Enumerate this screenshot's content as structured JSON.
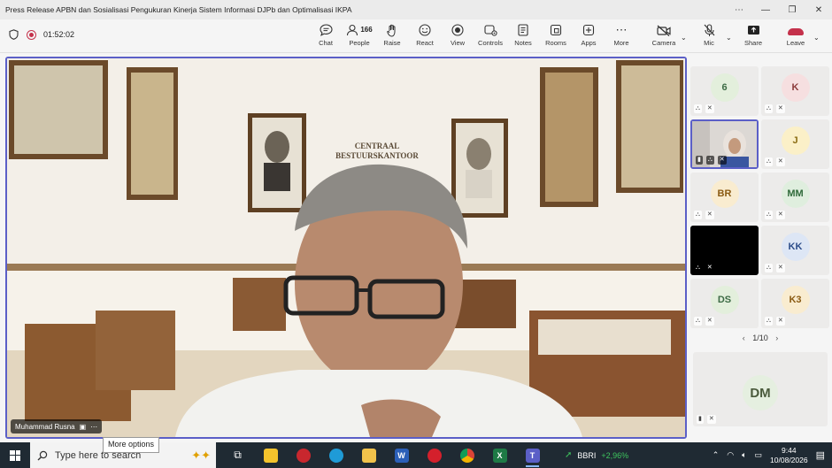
{
  "window": {
    "title": "Press Release APBN dan Sosialisasi Pengukuran Kinerja Sistem Informasi DJPb dan Optimalisasi IKPA",
    "buttons": [
      "⋯",
      "—",
      "❐",
      "✕"
    ]
  },
  "meeting": {
    "timer": "01:52:02",
    "toolbar": {
      "chat": "Chat",
      "people": "People",
      "people_count": "166",
      "raise": "Raise",
      "react": "React",
      "view": "View",
      "controls": "Controls",
      "notes": "Notes",
      "rooms": "Rooms",
      "apps": "Apps",
      "more": "More",
      "camera": "Camera",
      "mic": "Mic",
      "share": "Share",
      "leave": "Leave"
    },
    "main_speaker": {
      "name": "Muhammad Rusna",
      "scene_sign_line1": "CENTRAAL",
      "scene_sign_line2": "BESTUURSKANTOOR"
    },
    "tooltip": "More options",
    "participants": [
      {
        "initials": "6",
        "bg": "#e3efdc",
        "fg": "#3d6b45"
      },
      {
        "initials": "K",
        "bg": "#f6dfe0",
        "fg": "#8b3a3a"
      },
      {
        "initials": "",
        "bg": "#d9d4d0",
        "fg": "#333",
        "video": true
      },
      {
        "initials": "J",
        "bg": "#fbf0c8",
        "fg": "#8a6b12"
      },
      {
        "initials": "BR",
        "bg": "#f9ecd0",
        "fg": "#8a5a12"
      },
      {
        "initials": "MM",
        "bg": "#dfeede",
        "fg": "#2f6a3a"
      },
      {
        "initials": "",
        "bg": "#000000",
        "fg": "#fff",
        "dark": true
      },
      {
        "initials": "KK",
        "bg": "#dde6f5",
        "fg": "#2d4d8a"
      },
      {
        "initials": "DS",
        "bg": "#e3efdc",
        "fg": "#3d6b45"
      },
      {
        "initials": "K3",
        "bg": "#f9ecd0",
        "fg": "#8a5a12"
      }
    ],
    "pager": "1/10",
    "self_initials": "DM"
  },
  "taskbar": {
    "search_placeholder": "Type here to search",
    "ticker_symbol": "BBRI",
    "ticker_change": "+2,96%",
    "time": "9:44",
    "date": "10/08/2026"
  }
}
